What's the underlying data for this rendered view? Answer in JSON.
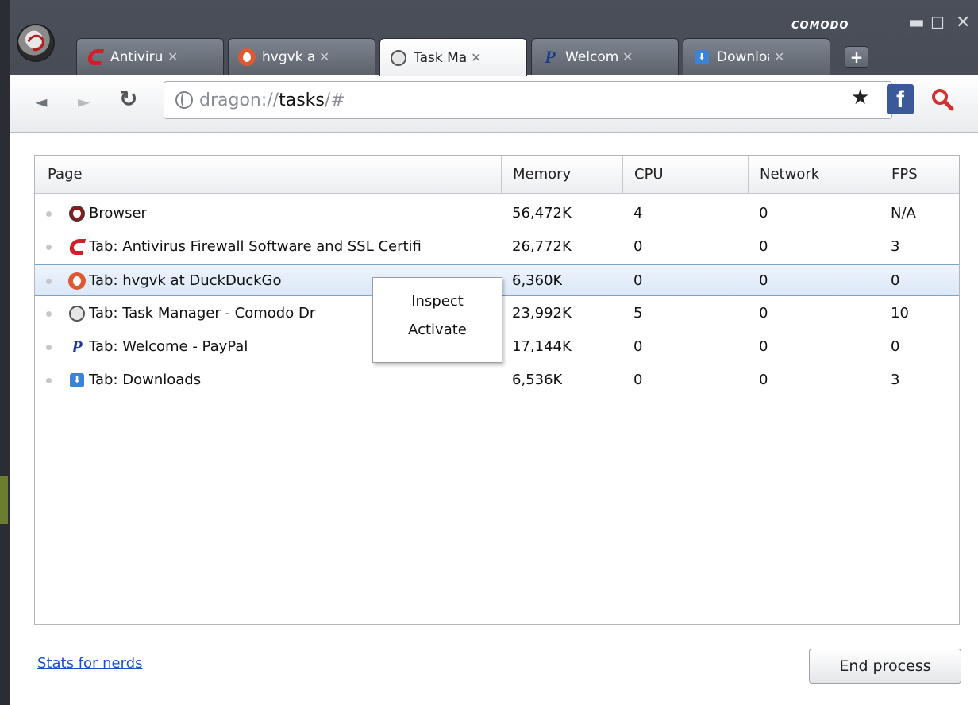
{
  "window": {
    "brand": "COMODO",
    "controls": {
      "minimize": "▬",
      "maximize": "☐",
      "close": "✕"
    }
  },
  "tabs": [
    {
      "icon": "comodo-icon",
      "label": "Antivirus Firewall Software and SSL Certificates",
      "close": "✕",
      "active": false
    },
    {
      "icon": "duckduckgo-icon",
      "label": "hvgvk at DuckDuckGo",
      "close": "✕",
      "active": false
    },
    {
      "icon": "globe-icon",
      "label": "Task Manager - Comodo Dragon",
      "close": "✕",
      "active": true
    },
    {
      "icon": "paypal-icon",
      "label": "Welcome - PayPal",
      "close": "✕",
      "active": false
    },
    {
      "icon": "downloads-icon",
      "label": "Downloads",
      "close": "✕",
      "active": false
    }
  ],
  "new_tab": "+",
  "toolbar": {
    "back": "◄",
    "forward": "►",
    "reload": "↻",
    "url_scheme": "dragon://",
    "url_host": "tasks",
    "url_rest": "/#",
    "bookmark": "★",
    "facebook": "f",
    "search_icon": "🔍"
  },
  "table": {
    "headers": [
      "Page",
      "Memory",
      "CPU",
      "Network",
      "FPS"
    ],
    "rows": [
      {
        "icon": "dragon-icon",
        "page": "Browser",
        "memory": "56,472K",
        "cpu": "4",
        "network": "0",
        "fps": "N/A"
      },
      {
        "icon": "comodo-icon",
        "page": "Tab: Antivirus Firewall Software and SSL Certifi",
        "memory": "26,772K",
        "cpu": "0",
        "network": "0",
        "fps": "3"
      },
      {
        "icon": "duckduckgo-icon",
        "page": "Tab: hvgvk at DuckDuckGo",
        "memory": "6,360K",
        "cpu": "0",
        "network": "0",
        "fps": "0"
      },
      {
        "icon": "globe-icon",
        "page": "Tab: Task Manager - Comodo Dr",
        "memory": "23,992K",
        "cpu": "5",
        "network": "0",
        "fps": "10"
      },
      {
        "icon": "paypal-icon",
        "page": "Tab: Welcome - PayPal",
        "memory": "17,144K",
        "cpu": "0",
        "network": "0",
        "fps": "0"
      },
      {
        "icon": "downloads-icon",
        "page": "Tab: Downloads",
        "memory": "6,536K",
        "cpu": "0",
        "network": "0",
        "fps": "3"
      }
    ],
    "selected_row": 2
  },
  "context_menu": {
    "items": [
      "Inspect",
      "Activate"
    ]
  },
  "footer": {
    "stats_link": "Stats for nerds",
    "end_process": "End process"
  }
}
